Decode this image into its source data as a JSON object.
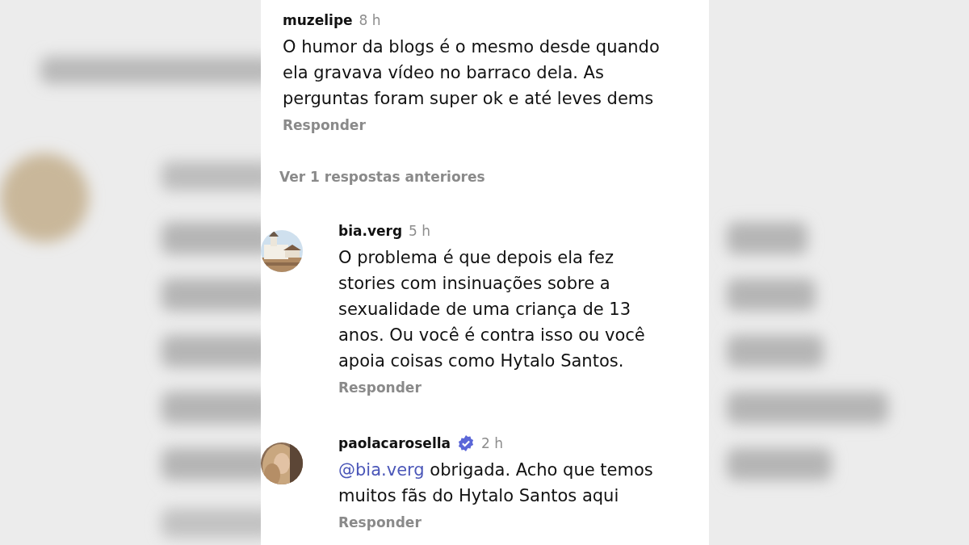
{
  "comments": [
    {
      "username": "muzelipe",
      "time": "8 h",
      "verified": false,
      "avatar": false,
      "text": "O humor da blogs é o mesmo desde quando\nela gravava vídeo no barraco dela. As\nperguntas foram super ok e até leves dems",
      "reply": "Responder"
    },
    {
      "kind": "more",
      "label": "Ver 1 respostas anteriores"
    },
    {
      "username": "bia.verg",
      "time": "5 h",
      "verified": false,
      "avatar": true,
      "text": "O problema é que depois ela fez\nstories com insinuações sobre a\nsexualidade de uma criança de 13\nanos. Ou você é contra isso ou você\napoia coisas como Hytalo Santos.",
      "reply": "Responder"
    },
    {
      "username": "paolacarosella",
      "time": "2 h",
      "verified": true,
      "avatar": true,
      "mention": "@bia.verg",
      "text": " obrigada. Acho que temos\nmuitos fãs do Hytalo Santos aqui",
      "reply": "Responder"
    }
  ]
}
